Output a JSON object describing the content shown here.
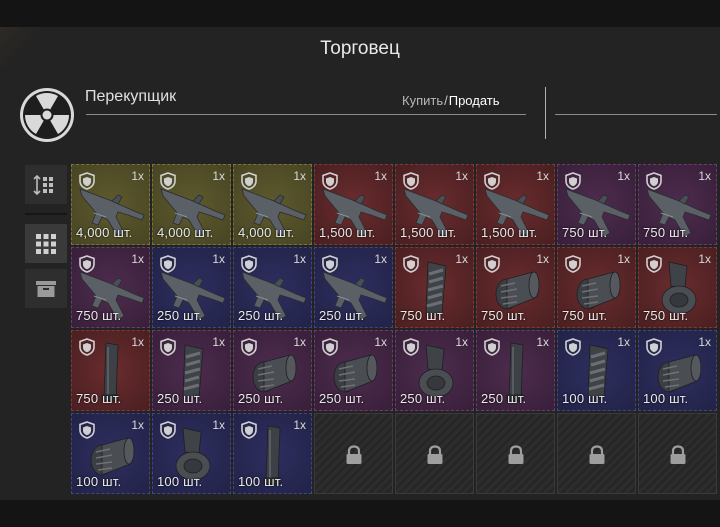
{
  "window": {
    "title": "Торговец"
  },
  "trader": {
    "name": "Перекупщик",
    "buy_label": "Купить",
    "slash": "/",
    "sell_label": "Продать",
    "icon": "radiation-icon"
  },
  "sidebar": {
    "buttons": [
      {
        "icon": "sort-icon",
        "active": false
      },
      {
        "icon": "grid-view-icon",
        "active": true
      },
      {
        "icon": "archive-icon",
        "active": false
      }
    ]
  },
  "grid": {
    "cells": [
      {
        "color": "yellow",
        "item": "smg",
        "mult": "1x",
        "qty": "4,000 шт."
      },
      {
        "color": "yellow",
        "item": "smg",
        "mult": "1x",
        "qty": "4,000 шт."
      },
      {
        "color": "yellow",
        "item": "smg",
        "mult": "1x",
        "qty": "4,000 шт."
      },
      {
        "color": "red",
        "item": "smg",
        "mult": "1x",
        "qty": "1,500 шт."
      },
      {
        "color": "red",
        "item": "smg",
        "mult": "1x",
        "qty": "1,500 шт."
      },
      {
        "color": "red",
        "item": "smg",
        "mult": "1x",
        "qty": "1,500 шт."
      },
      {
        "color": "violet",
        "item": "smg",
        "mult": "1x",
        "qty": "750 шт."
      },
      {
        "color": "violet",
        "item": "smg",
        "mult": "1x",
        "qty": "750 шт."
      },
      {
        "color": "violet",
        "item": "smg",
        "mult": "1x",
        "qty": "750 шт."
      },
      {
        "color": "blue",
        "item": "smg",
        "mult": "1x",
        "qty": "250 шт."
      },
      {
        "color": "blue",
        "item": "smg",
        "mult": "1x",
        "qty": "250 шт."
      },
      {
        "color": "blue",
        "item": "smg",
        "mult": "1x",
        "qty": "250 шт."
      },
      {
        "color": "red",
        "item": "grip",
        "mult": "1x",
        "qty": "750 шт."
      },
      {
        "color": "red",
        "item": "muzzle",
        "mult": "1x",
        "qty": "750 шт."
      },
      {
        "color": "red",
        "item": "muzzle",
        "mult": "1x",
        "qty": "750 шт."
      },
      {
        "color": "red",
        "item": "drum",
        "mult": "1x",
        "qty": "750 шт."
      },
      {
        "color": "red",
        "item": "mag",
        "mult": "1x",
        "qty": "750 шт."
      },
      {
        "color": "violet",
        "item": "grip",
        "mult": "1x",
        "qty": "250 шт."
      },
      {
        "color": "violet",
        "item": "muzzle",
        "mult": "1x",
        "qty": "250 шт."
      },
      {
        "color": "violet",
        "item": "muzzle",
        "mult": "1x",
        "qty": "250 шт."
      },
      {
        "color": "violet",
        "item": "drum",
        "mult": "1x",
        "qty": "250 шт."
      },
      {
        "color": "violet",
        "item": "mag",
        "mult": "1x",
        "qty": "250 шт."
      },
      {
        "color": "blue",
        "item": "grip",
        "mult": "1x",
        "qty": "100 шт."
      },
      {
        "color": "blue",
        "item": "muzzle",
        "mult": "1x",
        "qty": "100 шт."
      },
      {
        "color": "blue",
        "item": "muzzle",
        "mult": "1x",
        "qty": "100 шт."
      },
      {
        "color": "blue",
        "item": "drum",
        "mult": "1x",
        "qty": "100 шт."
      },
      {
        "color": "blue",
        "item": "mag",
        "mult": "1x",
        "qty": "100 шт."
      },
      {
        "color": "locked",
        "item": "lock",
        "mult": "",
        "qty": ""
      },
      {
        "color": "locked",
        "item": "lock",
        "mult": "",
        "qty": ""
      },
      {
        "color": "locked",
        "item": "lock",
        "mult": "",
        "qty": ""
      },
      {
        "color": "locked",
        "item": "lock",
        "mult": "",
        "qty": ""
      },
      {
        "color": "locked",
        "item": "lock",
        "mult": "",
        "qty": ""
      }
    ]
  }
}
